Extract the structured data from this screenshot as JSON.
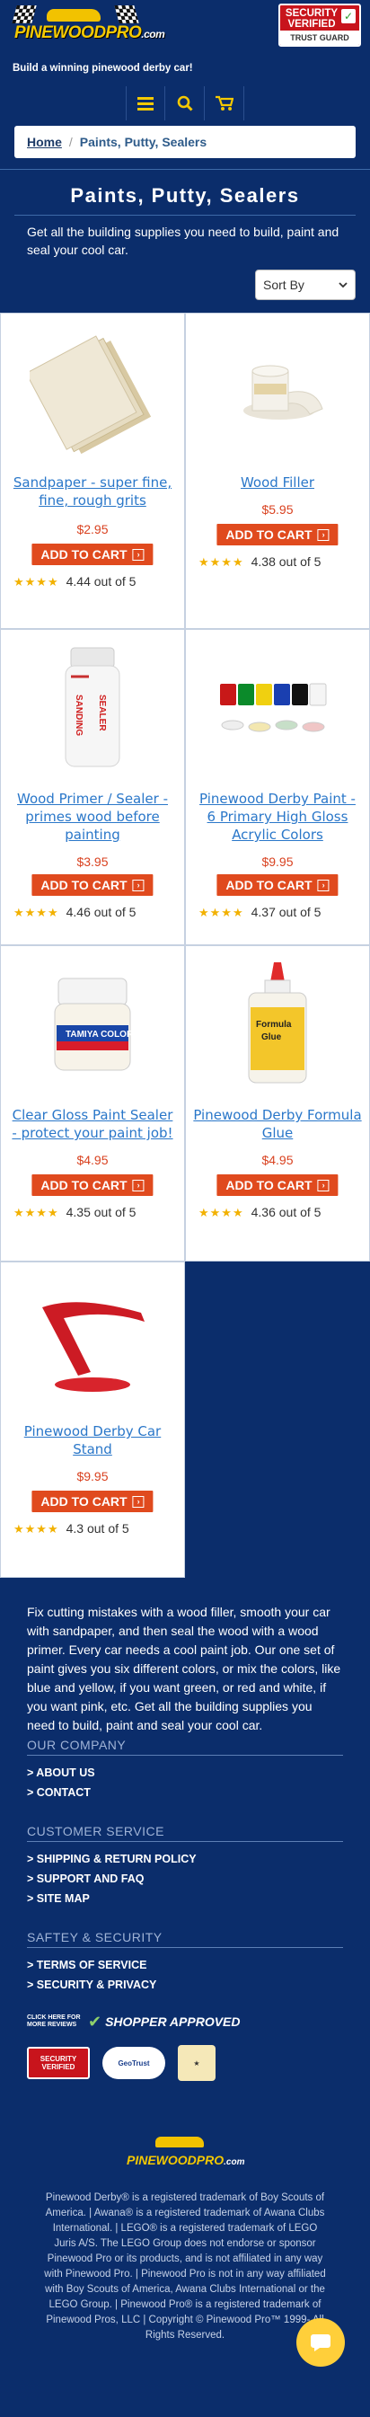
{
  "header": {
    "logo_text": "PINEWOODPRO",
    "logo_com": ".com",
    "tagline": "Build a winning pinewood derby car!",
    "badge_top": "SECURITY VERIFIED",
    "badge_bottom": "TRUST GUARD"
  },
  "iconbar": {
    "icons": [
      "menu-icon",
      "search-icon",
      "cart-icon"
    ],
    "color": "#f5c900"
  },
  "breadcrumb": {
    "home": "Home",
    "separator": "/",
    "current": "Paints, Putty, Sealers"
  },
  "page": {
    "title": "Paints, Putty, Sealers",
    "intro": "Get all the building supplies you need to build, paint and seal your cool car.",
    "sort_label": "Sort By"
  },
  "products": [
    {
      "title": "Sandpaper - super fine, fine, rough grits",
      "price": "$2.95",
      "button": "ADD TO CART",
      "rating": 4.44,
      "rating_text": "4.44 out of 5",
      "image": "sandpaper"
    },
    {
      "title": "Wood Filler",
      "price": "$5.95",
      "button": "ADD TO CART",
      "rating": 4.38,
      "rating_text": "4.38 out of 5",
      "image": "wood-filler"
    },
    {
      "title": "Wood Primer / Sealer - primes wood before painting",
      "price": "$3.95",
      "button": "ADD TO CART",
      "rating": 4.46,
      "rating_text": "4.46 out of 5",
      "image": "primer-bottle"
    },
    {
      "title": "Pinewood Derby Paint - 6 Primary High Gloss Acrylic Colors",
      "price": "$9.95",
      "button": "ADD TO CART",
      "rating": 4.37,
      "rating_text": "4.37 out of 5",
      "image": "paint-set"
    },
    {
      "title": "Clear Gloss Paint Sealer - protect your paint job!",
      "price": "$4.95",
      "button": "ADD TO CART",
      "rating": 4.35,
      "rating_text": "4.35 out of 5",
      "image": "tamiya-jar"
    },
    {
      "title": "Pinewood Derby Formula Glue",
      "price": "$4.95",
      "button": "ADD TO CART",
      "rating": 4.36,
      "rating_text": "4.36 out of 5",
      "image": "glue-bottle"
    },
    {
      "title": "Pinewood Derby Car Stand",
      "price": "$9.95",
      "button": "ADD TO CART",
      "rating": 4.3,
      "rating_text": "4.3 out of 5",
      "image": "car-stand"
    }
  ],
  "description": "Fix cutting mistakes with a wood filler, smooth your car with sandpaper, and then seal the wood with a wood primer. Every car needs a cool paint job.  Our one set of paint gives you six different colors, or mix the colors, like blue and yellow, if you want green, or red and white, if you want pink, etc.  Get all the building supplies you need to build, paint and seal your cool car.",
  "footer": {
    "company": {
      "heading": "OUR COMPANY",
      "links": [
        "> ABOUT US",
        "> CONTACT"
      ]
    },
    "service": {
      "heading": "CUSTOMER SERVICE",
      "links": [
        "> SHIPPING & RETURN POLICY",
        "> SUPPORT AND FAQ",
        "> SITE MAP"
      ]
    },
    "safety": {
      "heading": "SAFTEY & SECURITY",
      "links": [
        "> TERMS OF SERVICE",
        "> SECURITY & PRIVACY"
      ]
    },
    "reviews_label": "CLICK HERE FOR MORE REVIEWS",
    "shopper_approved": "SHOPPER APPROVED",
    "badge_security": "SECURITY VERIFIED",
    "badge_trust": "TRUST GUARD",
    "badge_geotrust": "GeoTrust",
    "legal": "Pinewood Derby® is a registered trademark of Boy Scouts of America. | Awana® is a registered trademark of Awana Clubs International. | LEGO® is a registered trademark of LEGO Juris A/S. The LEGO Group does not endorse or sponsor Pinewood Pro or its products, and is not affiliated in any way with Pinewood Pro. | Pinewood Pro is not in any way affiliated with Boy Scouts of America, Awana Clubs International or the LEGO Group. | Pinewood Pro® is a registered trademark of Pinewood Pros, LLC | Copyright © Pinewood Pro™ 1999- All Rights Reserved."
  },
  "colors": {
    "background": "#0b2d6b",
    "accent": "#f5c900",
    "cart_button": "#e04a1e",
    "price": "#d94220",
    "link": "#2a77c9"
  }
}
